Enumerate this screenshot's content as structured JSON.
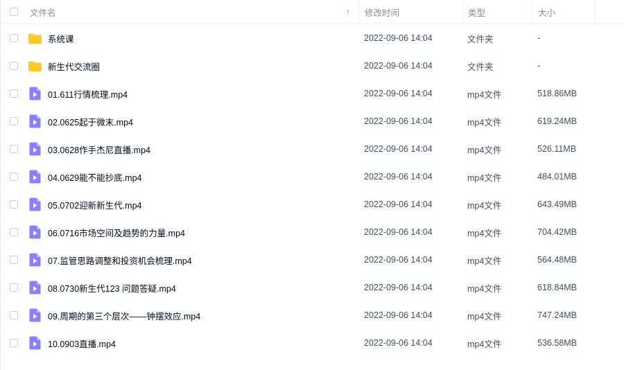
{
  "header": {
    "name": "文件名",
    "modified": "修改时间",
    "type": "类型",
    "size": "大小"
  },
  "colors": {
    "folder": "#ffca28",
    "video": "#8a80ff",
    "sort_arrow": "#06a7ff"
  },
  "files": [
    {
      "icon": "folder-icon",
      "name": "系统课",
      "modified": "2022-09-06 14:04",
      "type": "文件夹",
      "size": "-"
    },
    {
      "icon": "folder-icon",
      "name": "新生代交流圈",
      "modified": "2022-09-06 14:04",
      "type": "文件夹",
      "size": "-"
    },
    {
      "icon": "video-file-icon",
      "name": "01.611行情梳理.mp4",
      "modified": "2022-09-06 14:04",
      "type": "mp4文件",
      "size": "518.86MB"
    },
    {
      "icon": "video-file-icon",
      "name": "02.0625起于微末.mp4",
      "modified": "2022-09-06 14:04",
      "type": "mp4文件",
      "size": "619.24MB"
    },
    {
      "icon": "video-file-icon",
      "name": "03.0628作手杰尼直播.mp4",
      "modified": "2022-09-06 14:04",
      "type": "mp4文件",
      "size": "526.11MB"
    },
    {
      "icon": "video-file-icon",
      "name": "04.0629能不能抄底.mp4",
      "modified": "2022-09-06 14:04",
      "type": "mp4文件",
      "size": "484.01MB"
    },
    {
      "icon": "video-file-icon",
      "name": "05.0702迎新新生代.mp4",
      "modified": "2022-09-06 14:04",
      "type": "mp4文件",
      "size": "643.49MB"
    },
    {
      "icon": "video-file-icon",
      "name": "06.0716市场空间及趋势的力量.mp4",
      "modified": "2022-09-06 14:04",
      "type": "mp4文件",
      "size": "704.42MB"
    },
    {
      "icon": "video-file-icon",
      "name": "07.监管思路调整和投资机会梳理.mp4",
      "modified": "2022-09-06 14:04",
      "type": "mp4文件",
      "size": "564.48MB"
    },
    {
      "icon": "video-file-icon",
      "name": "08.0730新生代123  问题答疑.mp4",
      "modified": "2022-09-06 14:04",
      "type": "mp4文件",
      "size": "618.84MB"
    },
    {
      "icon": "video-file-icon",
      "name": "09.周期的第三个层次——钟摆效应.mp4",
      "modified": "2022-09-06 14:04",
      "type": "mp4文件",
      "size": "747.24MB"
    },
    {
      "icon": "video-file-icon",
      "name": "10.0903直播.mp4",
      "modified": "2022-09-06 14:04",
      "type": "mp4文件",
      "size": "536.58MB"
    }
  ]
}
